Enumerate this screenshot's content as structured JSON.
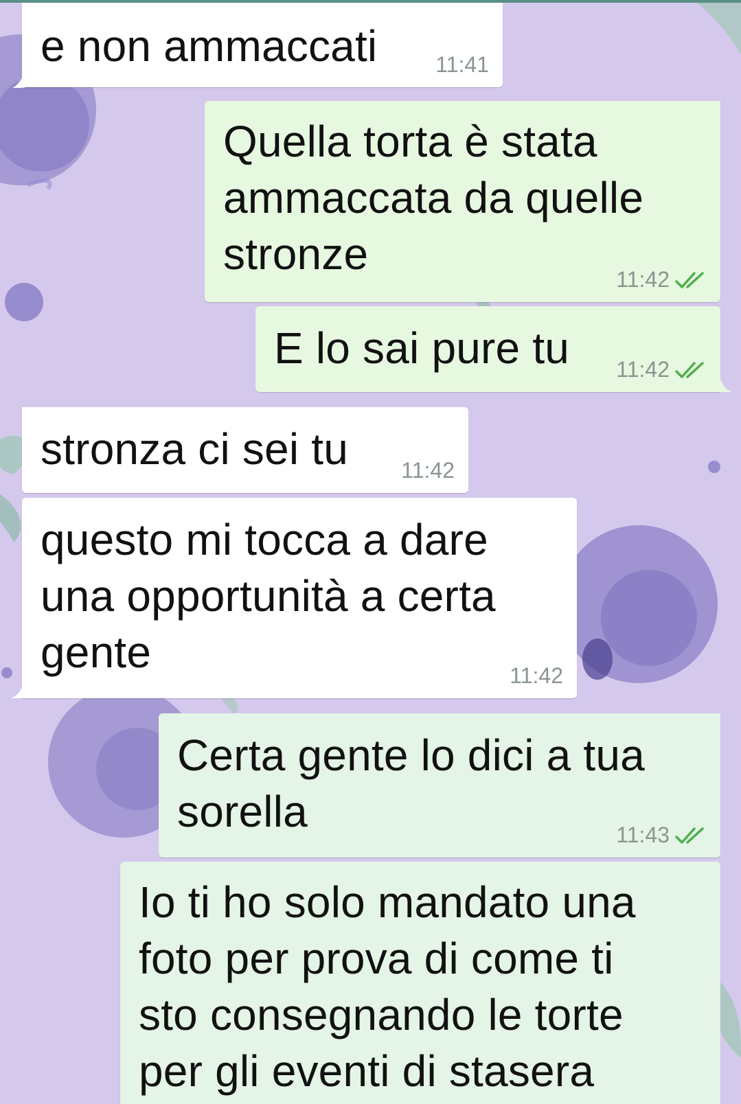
{
  "theme": {
    "incoming_bg": "#ffffff",
    "outgoing_bg": "#e7f8e0",
    "wallpaper_base": "#d9cff0",
    "read_tick_color": "#4fae4e"
  },
  "messages": [
    {
      "direction": "incoming",
      "text": "e non ammaccati",
      "time": "11:41",
      "status": ""
    },
    {
      "direction": "outgoing",
      "text": "Quella torta è stata\nammaccata da quelle\nstronze",
      "time": "11:42",
      "status": "read-double-check"
    },
    {
      "direction": "outgoing",
      "text": "E lo sai pure tu",
      "time": "11:42",
      "status": "read-double-check"
    },
    {
      "direction": "incoming",
      "text": "stronza ci sei tu",
      "time": "11:42",
      "status": ""
    },
    {
      "direction": "incoming",
      "text": "questo mi tocca a dare\nuna opportunità a certa\ngente",
      "time": "11:42",
      "status": ""
    },
    {
      "direction": "outgoing",
      "text": "Certa gente lo dici a tua\nsorella",
      "time": "11:43",
      "status": "read-double-check"
    },
    {
      "direction": "outgoing",
      "text": "Io ti ho solo mandato una\nfoto per prova di come ti\nsto consegnando le torte\nper gli eventi di stasera",
      "time": "",
      "status": ""
    }
  ]
}
